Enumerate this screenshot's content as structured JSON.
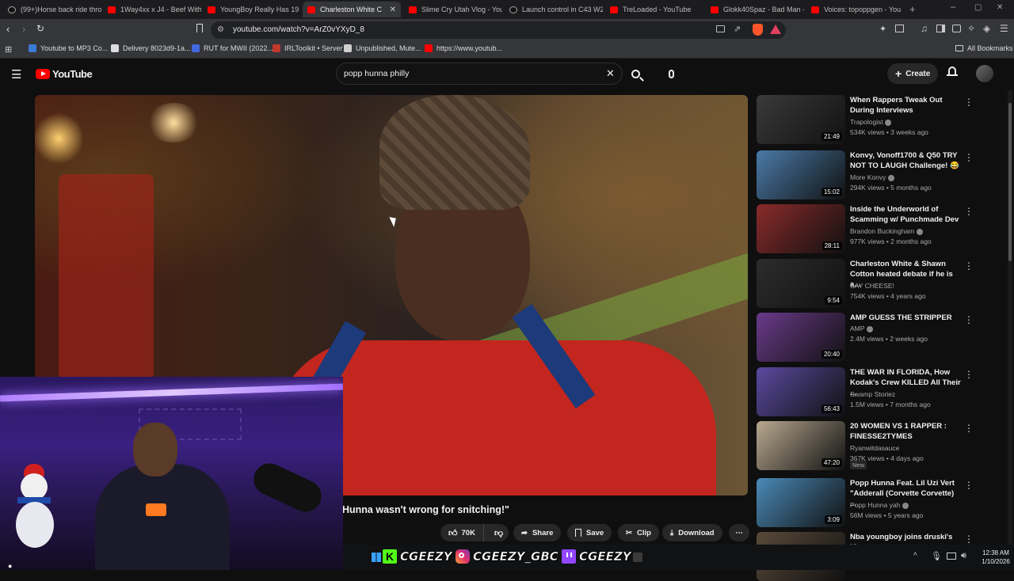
{
  "browser": {
    "tabs": [
      {
        "label": "(99+)Horse back ride thro",
        "kind": "tt"
      },
      {
        "label": "1Way4xx x J4 - Beef With",
        "kind": "yt"
      },
      {
        "label": "YoungBoy Really Has 19 B",
        "kind": "yt"
      },
      {
        "label": "Charleston White C",
        "kind": "yt"
      },
      {
        "label": "Slime Cry Utah Vlog - You",
        "kind": "yt"
      },
      {
        "label": "Launch control in C43 W2",
        "kind": "tt"
      },
      {
        "label": "TreLoaded - YouTube",
        "kind": "yt"
      },
      {
        "label": "Glokk40Spaz - Bad Man -",
        "kind": "yt"
      },
      {
        "label": "Voices: topoppgen - You",
        "kind": "yt"
      }
    ],
    "url": "youtube.com/watch?v=ArZ0vYXyD_8",
    "bookmarks": [
      {
        "label": "Youtube to MP3 Co...",
        "color": "#3a7bd5"
      },
      {
        "label": "Delivery 8023d9-1a...",
        "color": "#dddddd"
      },
      {
        "label": "RUT for MWII (2022...",
        "color": "#4169e1"
      },
      {
        "label": "IRLToolkit • Server",
        "color": "#c0392b"
      },
      {
        "label": "Unpublished, Mute...",
        "color": "#d0d0d0"
      },
      {
        "label": "https://www.youtub...",
        "color": "#ff0000"
      }
    ],
    "all_bookmarks": "All Bookmarks"
  },
  "youtube": {
    "logo": "YouTube",
    "search_value": "popp hunna philly",
    "create_label": "Create"
  },
  "video": {
    "caption": "Hunna wasn't wrong for snitching!\"",
    "like_count": "70K",
    "share": "Share",
    "save": "Save",
    "clip": "Clip",
    "download": "Download"
  },
  "sidebar": [
    {
      "title": "When Rappers Tweak Out During Interviews",
      "channel": "Trapologist",
      "verified": true,
      "views": "534K views",
      "age": "3 weeks ago",
      "duration": "21:49",
      "thumb": "#3a3a3a"
    },
    {
      "title": "Konvy, Vonoff1700 & Q50 TRY NOT TO LAUGH Challenge! 😂",
      "channel": "More Konvy",
      "verified": true,
      "views": "294K views",
      "age": "5 months ago",
      "duration": "15:02",
      "thumb": "#4a7aa8"
    },
    {
      "title": "Inside the Underworld of Scamming w/ Punchmade Dev",
      "channel": "Brandon Buckingham",
      "verified": true,
      "views": "977K views",
      "age": "2 months ago",
      "duration": "28:11",
      "thumb": "#8a2a2a"
    },
    {
      "title": "Charleston White & Shawn Cotton heated debate if he is a...",
      "channel": "SAY CHEESE!",
      "verified": false,
      "views": "754K views",
      "age": "4 years ago",
      "duration": "9:54",
      "thumb": "#2c2c2c"
    },
    {
      "title": "AMP GUESS THE STRIPPER",
      "channel": "AMP",
      "verified": true,
      "views": "2.4M views",
      "age": "2 weeks ago",
      "duration": "20:40",
      "thumb": "#6a3a8a"
    },
    {
      "title": "THE WAR IN FLORIDA, How Kodak's Crew KILLED All Their ...",
      "channel": "Swamp Storiez",
      "verified": false,
      "views": "1.5M views",
      "age": "7 months ago",
      "duration": "56:43",
      "thumb": "#5a4aa0"
    },
    {
      "title": "20 WOMEN VS 1 RAPPER : FINESSE2TYMES",
      "channel": "Ryanwitdasauce",
      "verified": false,
      "views": "367K views",
      "age": "4 days ago",
      "duration": "47:20",
      "thumb": "#b8a890",
      "badge": "New"
    },
    {
      "title": "Popp Hunna Feat. Lil Uzi Vert \"Adderall (Corvette Corvette) ...",
      "channel": "Popp Hunna yah",
      "verified": true,
      "views": "56M views",
      "age": "5 years ago",
      "duration": "3:09",
      "thumb": "#4a8ab8"
    },
    {
      "title": "Nba youngboy joins druski's IG",
      "channel": "",
      "verified": false,
      "views": "",
      "age": "",
      "duration": "",
      "thumb": "#5a4a3a"
    }
  ],
  "stream_overlay": {
    "kick": "CGEEZY",
    "instagram": "CGEEZY_GBC",
    "twitch": "CGEEZY"
  },
  "taskbar": {
    "time": "12:38 AM",
    "date": "1/10/2026"
  }
}
